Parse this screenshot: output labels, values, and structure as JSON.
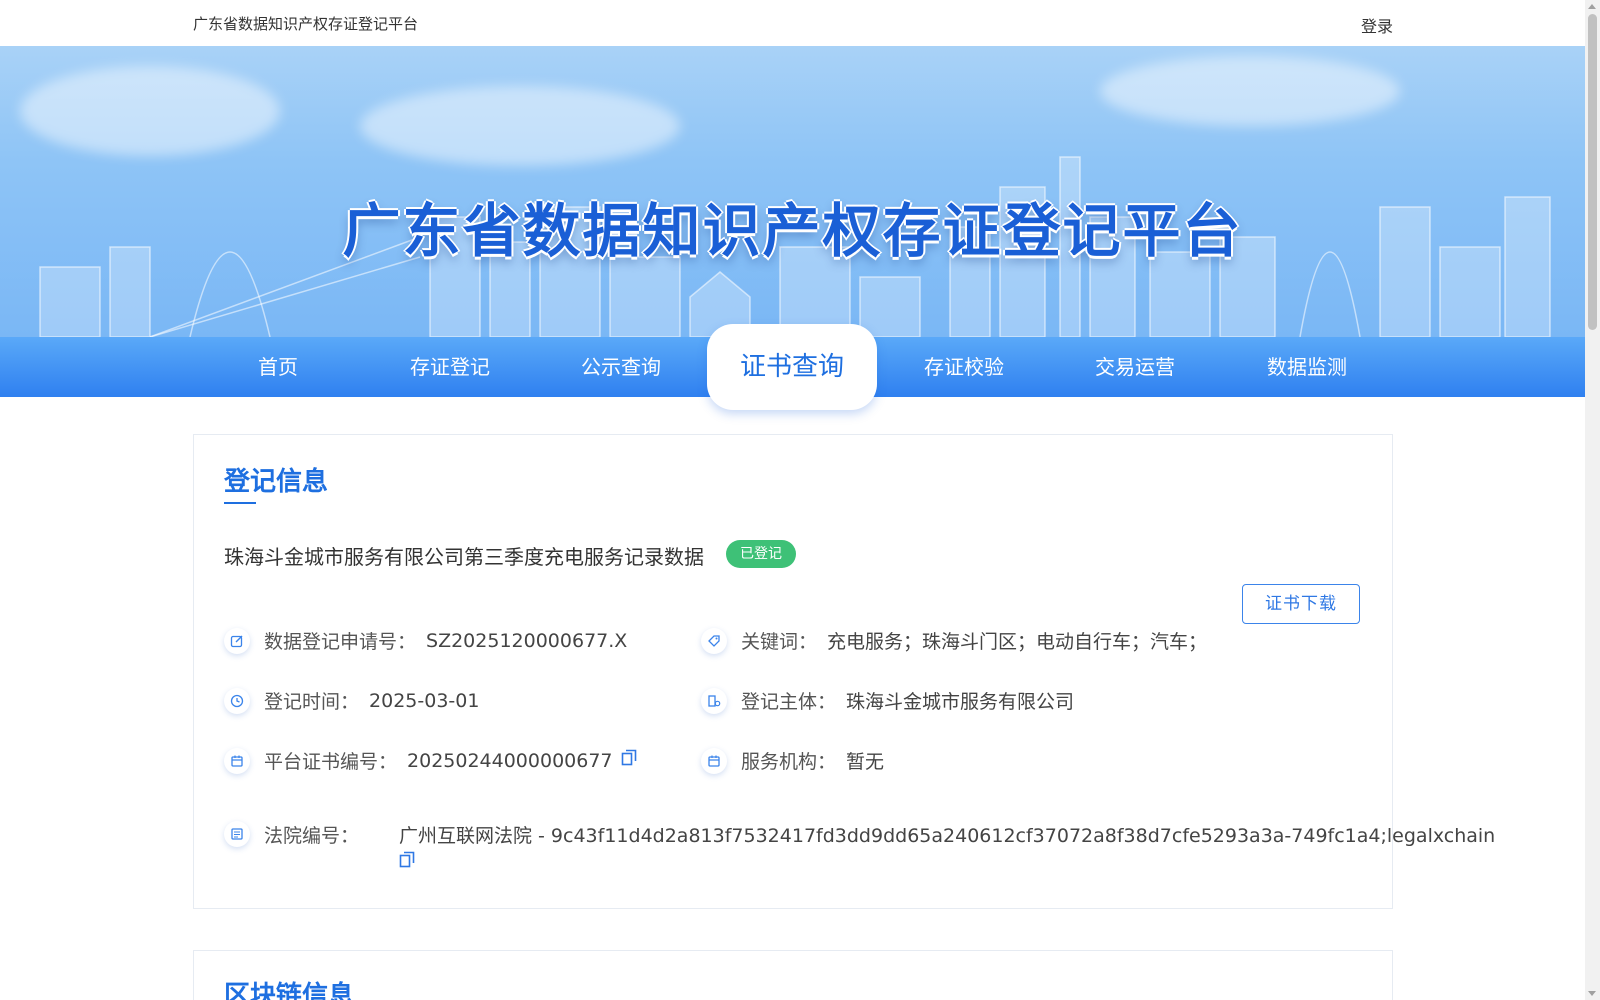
{
  "header": {
    "site_name": "广东省数据知识产权存证登记平台",
    "login_label": "登录"
  },
  "hero": {
    "title": "广东省数据知识产权存证登记平台"
  },
  "nav": {
    "items": [
      {
        "label": "首页"
      },
      {
        "label": "存证登记"
      },
      {
        "label": "公示查询"
      },
      {
        "label": "证书查询",
        "active": true
      },
      {
        "label": "存证校验"
      },
      {
        "label": "交易运营"
      },
      {
        "label": "数据监测"
      }
    ]
  },
  "registration": {
    "section_title": "登记信息",
    "record_name": "珠海斗金城市服务有限公司第三季度充电服务记录数据",
    "status": "已登记",
    "download_label": "证书下载",
    "fields": {
      "application_no_label": "数据登记申请号：",
      "application_no": "SZ2025120000677.X",
      "keywords_label": "关键词：",
      "keywords": "充电服务；珠海斗门区；电动自行车；汽车；",
      "reg_time_label": "登记时间：",
      "reg_time": "2025-03-01",
      "subject_label": "登记主体：",
      "subject": "珠海斗金城市服务有限公司",
      "cert_no_label": "平台证书编号：",
      "cert_no": "20250244000000677",
      "agency_label": "服务机构：",
      "agency": "暂无",
      "court_no_label": "法院编号：",
      "court_no": "广州互联网法院 - 9c43f11d4d2a813f7532417fd3dd9dd65a240612cf37072a8f38d7cfe5293a3a-749fc1a4;legalxchain"
    }
  },
  "blockchain": {
    "section_title": "区块链信息"
  },
  "colors": {
    "brand_blue": "#1e6fe0",
    "nav_gradient_top": "#5aa9f8",
    "nav_gradient_bottom": "#2f80f0",
    "status_green": "#3ec177"
  }
}
